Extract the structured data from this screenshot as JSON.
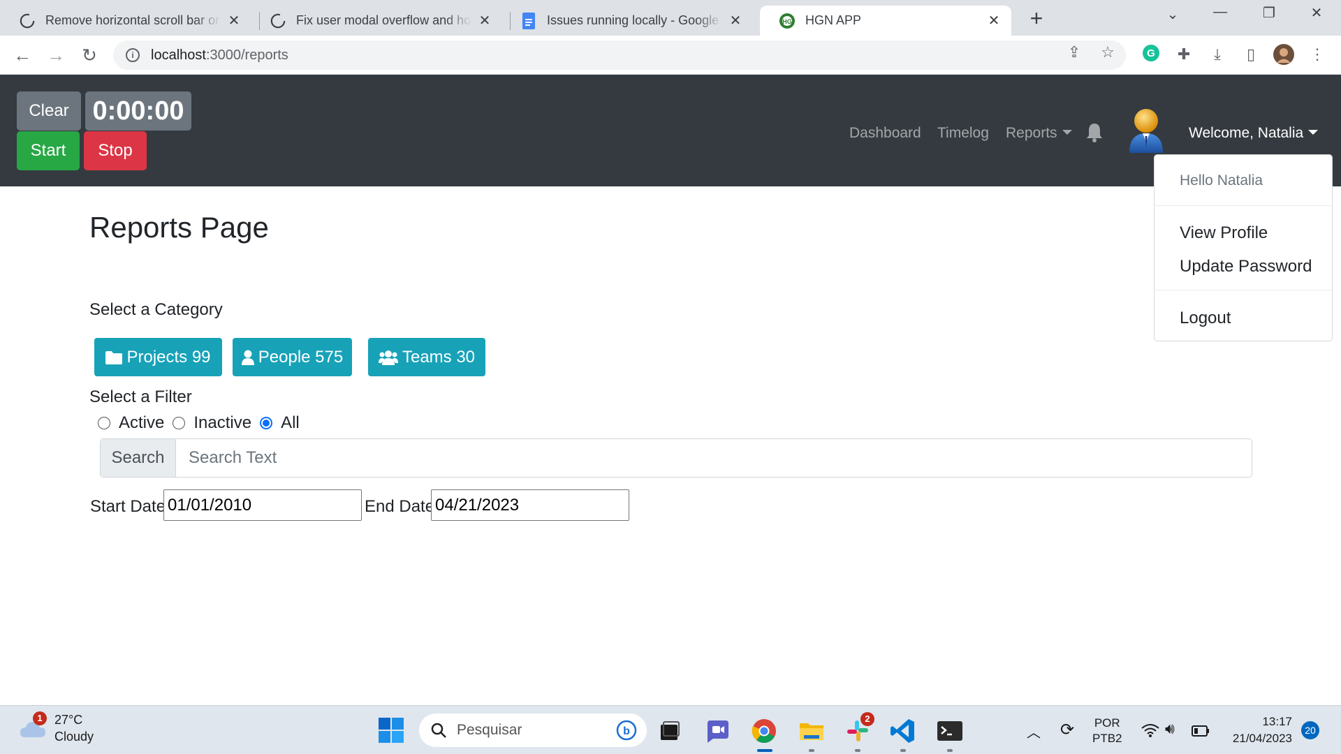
{
  "browser": {
    "tabs": [
      {
        "title": "Remove horizontal scroll bar on c",
        "icon": "github-icon",
        "active": false
      },
      {
        "title": "Fix user modal overflow and hori",
        "icon": "github-icon",
        "active": false
      },
      {
        "title": "Issues running locally - Google D",
        "icon": "google-docs-icon",
        "active": false
      },
      {
        "title": "HGN APP",
        "icon": "hgn-icon",
        "active": true
      }
    ],
    "url_host": "localhost",
    "url_path": ":3000/reports"
  },
  "timer": {
    "clear_label": "Clear",
    "time": "0:00:00",
    "start_label": "Start",
    "stop_label": "Stop"
  },
  "nav": {
    "dashboard": "Dashboard",
    "timelog": "Timelog",
    "reports": "Reports",
    "welcome": "Welcome, Natalia"
  },
  "user_menu": {
    "header": "Hello Natalia",
    "view_profile": "View Profile",
    "update_password": "Update Password",
    "logout": "Logout"
  },
  "page": {
    "title": "Reports Page",
    "select_category": "Select a Category",
    "categories": {
      "projects": "Projects 99",
      "people": "People 575",
      "teams": "Teams 30"
    },
    "select_filter": "Select a Filter",
    "filters": {
      "active": "Active",
      "inactive": "Inactive",
      "all": "All",
      "selected": "All"
    },
    "search_label": "Search",
    "search_placeholder": "Search Text",
    "start_date_label": "Start Date",
    "start_date": "01/01/2010",
    "end_date_label": "End Date",
    "end_date": "04/21/2023"
  },
  "taskbar": {
    "weather_temp": "27°C",
    "weather_desc": "Cloudy",
    "weather_badge": "1",
    "search_placeholder": "Pesquisar",
    "slack_badge": "2",
    "lang_top": "POR",
    "lang_bottom": "PTB2",
    "time": "13:17",
    "date": "21/04/2023",
    "notification_count": "20"
  },
  "colors": {
    "header_bg": "#343a40",
    "info": "#17a2b8",
    "success": "#28a745",
    "danger": "#dc3545",
    "secondary": "#6c757d"
  }
}
